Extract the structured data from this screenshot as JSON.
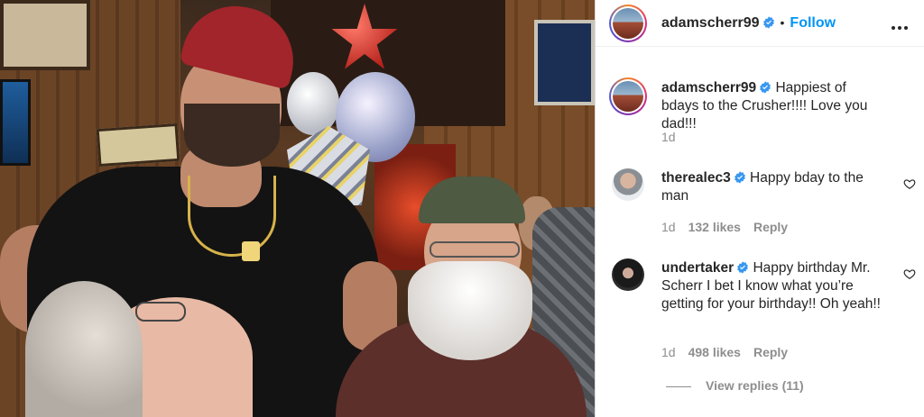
{
  "post": {
    "photo_alt": "Photo posted by adamscherr99",
    "author": "adamscherr99",
    "follow_label": "Follow",
    "separator": "•",
    "verified_icon": "verified-badge-icon",
    "more_icon": "more-options-icon"
  },
  "caption": {
    "username": "adamscherr99",
    "text": "Happiest of bdays to the Crusher!!!! Love you dad!!!",
    "time": "1d"
  },
  "comments": [
    {
      "username": "therealec3",
      "text": "Happy bday to the man",
      "time": "1d",
      "likes": "132 likes",
      "reply_label": "Reply"
    },
    {
      "username": "undertaker",
      "text": "Happy birthday Mr. Scherr I bet I know what you’re getting for your birthday!! Oh yeah!!",
      "time": "1d",
      "likes": "498 likes",
      "reply_label": "Reply"
    }
  ],
  "view_replies": "View replies (11)",
  "colors": {
    "accent": "#0095f6",
    "verified": "#3897f0",
    "muted": "#8e8e8e"
  }
}
